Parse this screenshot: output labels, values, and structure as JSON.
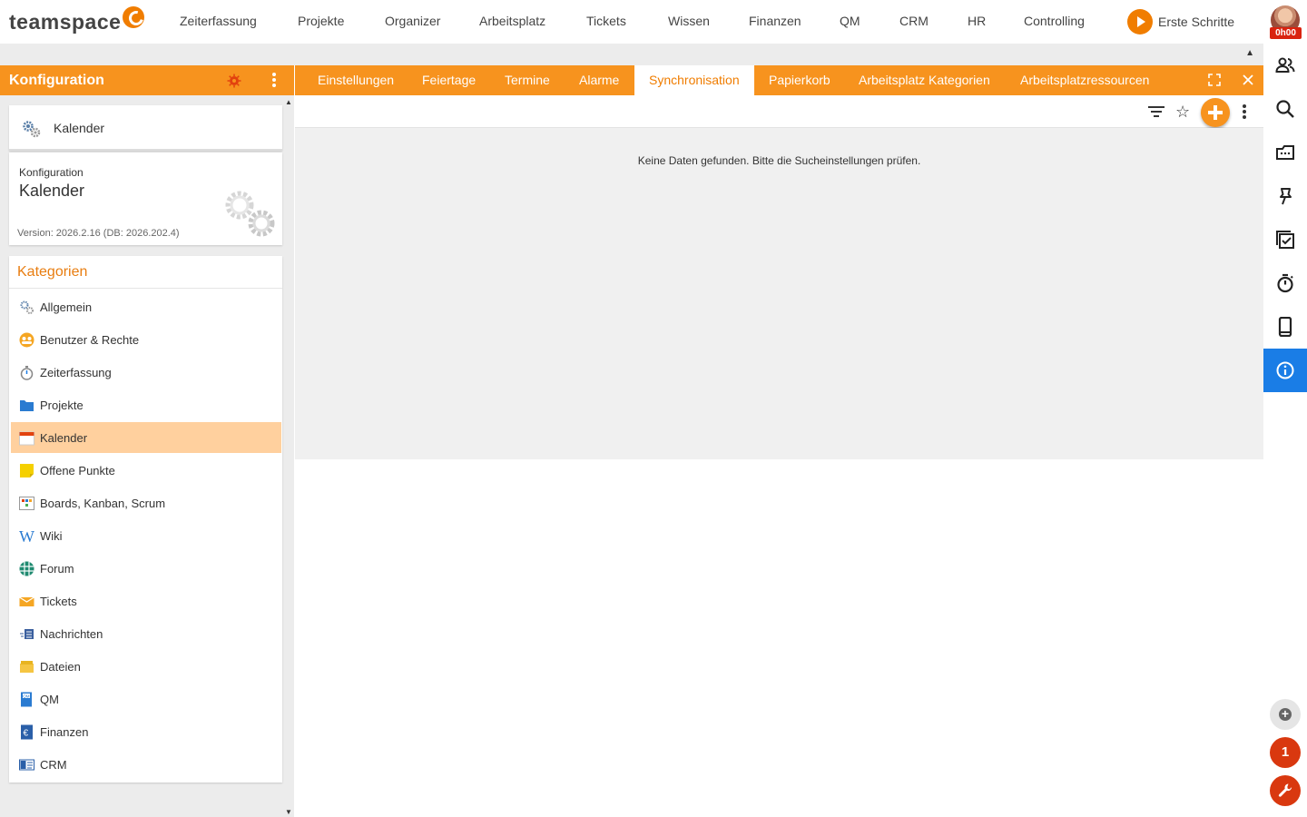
{
  "app": {
    "logo": "teamspace"
  },
  "topnav": {
    "items": [
      "Zeiterfassung",
      "Projekte",
      "Organizer",
      "Arbeitsplatz",
      "Tickets",
      "Wissen",
      "Finanzen",
      "QM",
      "CRM",
      "HR",
      "Controlling"
    ],
    "erste_schritte": "Erste Schritte",
    "time_badge": "0h00"
  },
  "left": {
    "title": "Konfiguration",
    "header_color": "#f7931e",
    "selected_card": "Kalender",
    "info": {
      "label": "Konfiguration",
      "title": "Kalender",
      "version": "Version: 2026.2.16 (DB: 2026.202.4)"
    },
    "categories_title": "Kategorien",
    "categories": [
      {
        "label": "Allgemein",
        "icon": "gears-icon"
      },
      {
        "label": "Benutzer & Rechte",
        "icon": "users-icon"
      },
      {
        "label": "Zeiterfassung",
        "icon": "stopwatch-icon"
      },
      {
        "label": "Projekte",
        "icon": "folder-icon"
      },
      {
        "label": "Kalender",
        "icon": "calendar-icon",
        "active": true
      },
      {
        "label": "Offene Punkte",
        "icon": "sticky-note-icon"
      },
      {
        "label": "Boards, Kanban, Scrum",
        "icon": "board-icon"
      },
      {
        "label": "Wiki",
        "icon": "wiki-icon"
      },
      {
        "label": "Forum",
        "icon": "forum-icon"
      },
      {
        "label": "Tickets",
        "icon": "ticket-icon"
      },
      {
        "label": "Nachrichten",
        "icon": "news-icon"
      },
      {
        "label": "Dateien",
        "icon": "files-icon"
      },
      {
        "label": "QM",
        "icon": "qm-icon"
      },
      {
        "label": "Finanzen",
        "icon": "euro-icon"
      },
      {
        "label": "CRM",
        "icon": "contact-card-icon"
      }
    ]
  },
  "main": {
    "tabs": [
      "Einstellungen",
      "Feiertage",
      "Termine",
      "Alarme",
      "Synchronisation",
      "Papierkorb",
      "Arbeitsplatz Kategorien",
      "Arbeitsplatzressourcen"
    ],
    "active_tab": "Synchronisation",
    "empty_message": "Keine Daten gefunden. Bitte die Sucheinstellungen prüfen."
  },
  "rightbar": {
    "icons": [
      "contacts-icon",
      "search-icon",
      "inbox-icon",
      "pin-icon",
      "task-check-icon",
      "timer-icon",
      "phone-icon",
      "info-icon"
    ],
    "active_icon": "info-icon",
    "notification_count": "1",
    "accent": "#1a7de6"
  }
}
